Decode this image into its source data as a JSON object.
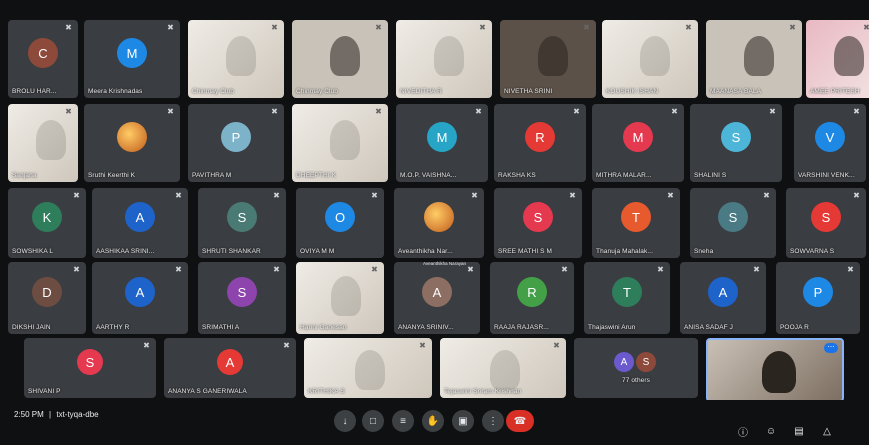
{
  "meeting": {
    "time": "2:50 PM",
    "separator": "|",
    "code": "txt-tyqa-dbe"
  },
  "tiles": [
    {
      "name": "BROLU HAR...",
      "initial": "C",
      "color": "#8d4a3a",
      "kind": "avatar"
    },
    {
      "name": "Meera Krishnadas",
      "initial": "M",
      "color": "#1e88e5",
      "kind": "avatar"
    },
    {
      "name": "Chinmay Club",
      "initial": "",
      "color": "",
      "kind": "video-paper"
    },
    {
      "name": "Chinmay Club",
      "initial": "",
      "color": "",
      "kind": "video"
    },
    {
      "name": "NIVEDITHA R",
      "initial": "",
      "color": "",
      "kind": "video-paper"
    },
    {
      "name": "NIVETHA SRINI",
      "initial": "",
      "color": "",
      "kind": "video-dark"
    },
    {
      "name": "KOUSHIK ISHAN",
      "initial": "",
      "color": "",
      "kind": "video-paper"
    },
    {
      "name": "MAANASA BALA",
      "initial": "",
      "color": "",
      "kind": "video"
    },
    {
      "name": "AMEE PRITESH",
      "initial": "",
      "color": "",
      "kind": "video-pink"
    },
    {
      "name": "Sanjana",
      "initial": "",
      "color": "",
      "kind": "video-paper"
    },
    {
      "name": "Sruthi Keerthi K",
      "initial": "",
      "color": "",
      "kind": "avatar-photo"
    },
    {
      "name": "PAVITHRA M",
      "initial": "P",
      "color": "#7cb3c9",
      "kind": "avatar"
    },
    {
      "name": "DHEEPTHI K",
      "initial": "",
      "color": "",
      "kind": "video-paper"
    },
    {
      "name": "M.O.P. VAISHNA...",
      "initial": "M",
      "color": "#26a5c6",
      "kind": "avatar"
    },
    {
      "name": "RAKSHA KS",
      "initial": "R",
      "color": "#e53935",
      "kind": "avatar"
    },
    {
      "name": "MITHRA MALAR...",
      "initial": "M",
      "color": "#e53950",
      "kind": "avatar"
    },
    {
      "name": "SHALINI S",
      "initial": "S",
      "color": "#4db6d8",
      "kind": "avatar"
    },
    {
      "name": "VARSHINI VENK...",
      "initial": "V",
      "color": "#1e88e5",
      "kind": "avatar"
    },
    {
      "name": "SOWSHIKA L",
      "initial": "K",
      "color": "#2e7d5b",
      "kind": "avatar"
    },
    {
      "name": "AASHIKAA SRINI...",
      "initial": "A",
      "color": "#1e63c9",
      "kind": "avatar"
    },
    {
      "name": "SHRUTI SHANKAR",
      "initial": "S",
      "color": "#4a7a74",
      "kind": "avatar"
    },
    {
      "name": "OVIYA M M",
      "initial": "O",
      "color": "#1e88e5",
      "kind": "avatar"
    },
    {
      "name": "Aveanthikha Nar...",
      "initial": "",
      "color": "",
      "kind": "avatar-photo"
    },
    {
      "name": "SREE MATHI S M",
      "initial": "S",
      "color": "#e53950",
      "kind": "avatar"
    },
    {
      "name": "Thanuja Mahalak...",
      "initial": "T",
      "color": "#e65a2e",
      "kind": "avatar"
    },
    {
      "name": "Sneha",
      "initial": "S",
      "color": "#4a7a84",
      "kind": "avatar"
    },
    {
      "name": "SOWVARNA S",
      "initial": "S",
      "color": "#e53935",
      "kind": "avatar"
    },
    {
      "name": "DIKSHI JAIN",
      "initial": "D",
      "color": "#6d4c41",
      "kind": "avatar"
    },
    {
      "name": "AARTHY R",
      "initial": "A",
      "color": "#1e63c9",
      "kind": "avatar"
    },
    {
      "name": "SRIMATHI A",
      "initial": "S",
      "color": "#8e44ad",
      "kind": "avatar"
    },
    {
      "name": "Harini Ganesan",
      "initial": "",
      "color": "",
      "kind": "video-paper"
    },
    {
      "name": "ANANYA SRINIV...",
      "initial": "A",
      "color": "#8d6e63",
      "kind": "avatar"
    },
    {
      "name": "RAAJA RAJASR...",
      "initial": "R",
      "color": "#43a047",
      "kind": "avatar"
    },
    {
      "name": "Thajaswini Arun",
      "initial": "T",
      "color": "#2e7d5b",
      "kind": "avatar"
    },
    {
      "name": "ANISA SADAF J",
      "initial": "A",
      "color": "#1e63c9",
      "kind": "avatar"
    },
    {
      "name": "POOJA R",
      "initial": "P",
      "color": "#1e88e5",
      "kind": "avatar"
    },
    {
      "name": "SHIVANI P",
      "initial": "S",
      "color": "#e53950",
      "kind": "avatar"
    },
    {
      "name": "ANANYA S GANERIWALA",
      "initial": "A",
      "color": "#e53935",
      "kind": "avatar"
    },
    {
      "name": "KRITHIKA S",
      "initial": "",
      "color": "",
      "kind": "video-paper"
    },
    {
      "name": "Tejaswini Sriram Krishnan",
      "initial": "",
      "color": "",
      "kind": "video-paper"
    },
    {
      "name": "77 others",
      "initial": "",
      "color": "",
      "kind": "others"
    },
    {
      "name": "",
      "initial": "",
      "color": "",
      "kind": "self"
    }
  ],
  "caption": "Aveanthikha Narayan",
  "others_avatars": [
    {
      "initial": "A",
      "color": "#6a5acd"
    },
    {
      "initial": "S",
      "color": "#8d4a3a"
    }
  ],
  "controls": [
    {
      "name": "mic-button",
      "icon": "↓"
    },
    {
      "name": "camera-button",
      "icon": "□"
    },
    {
      "name": "captions-button",
      "icon": "≡"
    },
    {
      "name": "raise-hand-button",
      "icon": "✋"
    },
    {
      "name": "present-button",
      "icon": "▣"
    },
    {
      "name": "more-options-button",
      "icon": "⋮"
    },
    {
      "name": "leave-call-button",
      "icon": "☎"
    }
  ],
  "right_controls": [
    {
      "name": "info-icon",
      "icon": "ⓘ"
    },
    {
      "name": "people-icon",
      "icon": "☺"
    },
    {
      "name": "chat-icon",
      "icon": "▤"
    },
    {
      "name": "activities-icon",
      "icon": "△"
    }
  ],
  "self_badge": "⋯"
}
